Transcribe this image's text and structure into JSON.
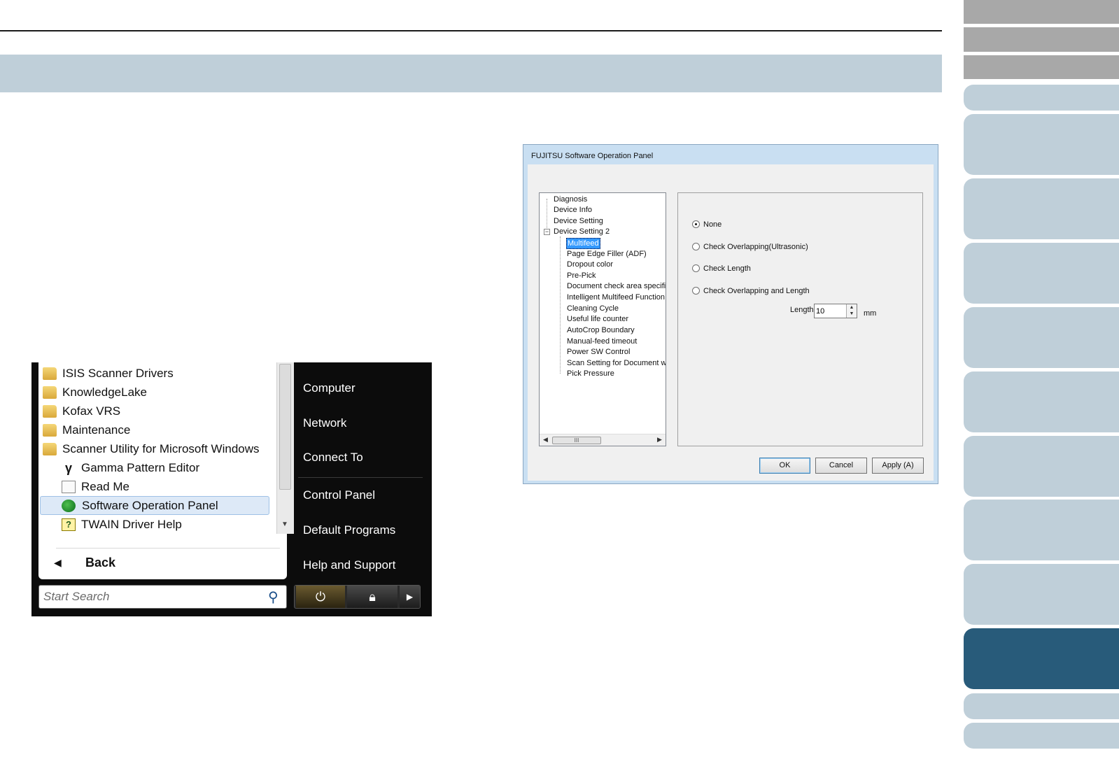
{
  "start_menu": {
    "programs": [
      {
        "label": "ISIS Scanner Drivers",
        "icon": "folder-icon"
      },
      {
        "label": "KnowledgeLake",
        "icon": "folder-icon"
      },
      {
        "label": "Kofax VRS",
        "icon": "folder-icon"
      },
      {
        "label": "Maintenance",
        "icon": "folder-icon"
      },
      {
        "label": "Scanner Utility for Microsoft Windows",
        "icon": "folder-icon"
      },
      {
        "label": "Gamma Pattern Editor",
        "icon": "gamma-icon"
      },
      {
        "label": "Read Me",
        "icon": "document-icon"
      },
      {
        "label": "Software Operation Panel",
        "icon": "software-operation-panel-icon",
        "highlighted": true
      },
      {
        "label": "TWAIN Driver Help",
        "icon": "help-file-icon"
      }
    ],
    "back_label": "Back",
    "search_placeholder": "Start Search",
    "right_items": [
      "Computer",
      "Network",
      "Connect To",
      "Control Panel",
      "Default Programs",
      "Help and Support"
    ],
    "power_buttons": [
      "power-icon",
      "lock-icon",
      "arrow-right-icon"
    ]
  },
  "dialog": {
    "title": "FUJITSU Software Operation Panel",
    "tree": {
      "top_items": [
        "Diagnosis",
        "Device Info",
        "Device Setting",
        "Device Setting 2"
      ],
      "children": [
        "Multifeed",
        "Page Edge Filler (ADF)",
        "Dropout color",
        "Pre-Pick",
        "Document check area specific",
        "Intelligent Multifeed Function",
        "Cleaning Cycle",
        "Useful life counter",
        "AutoCrop Boundary",
        "Manual-feed timeout",
        "Power SW Control",
        "Scan Setting for Document wit",
        "Pick Pressure"
      ],
      "selected": "Multifeed",
      "scroll_grip": "III"
    },
    "options": [
      {
        "label": "None",
        "selected": true
      },
      {
        "label": "Check Overlapping(Ultrasonic)",
        "selected": false
      },
      {
        "label": "Check Length",
        "selected": false
      },
      {
        "label": "Check Overlapping and Length",
        "selected": false
      }
    ],
    "length_label": "Length",
    "length_value": "10",
    "length_unit": "mm",
    "buttons": {
      "ok": "OK",
      "cancel": "Cancel",
      "apply": "Apply (A)"
    }
  },
  "colors": {
    "header_band": "#bfcfd9",
    "nav_tab": "#bfcfd9",
    "nav_tab_active": "#285b7a",
    "nav_tab_gray": "#a8a8a8",
    "highlight": "#3399ff"
  }
}
